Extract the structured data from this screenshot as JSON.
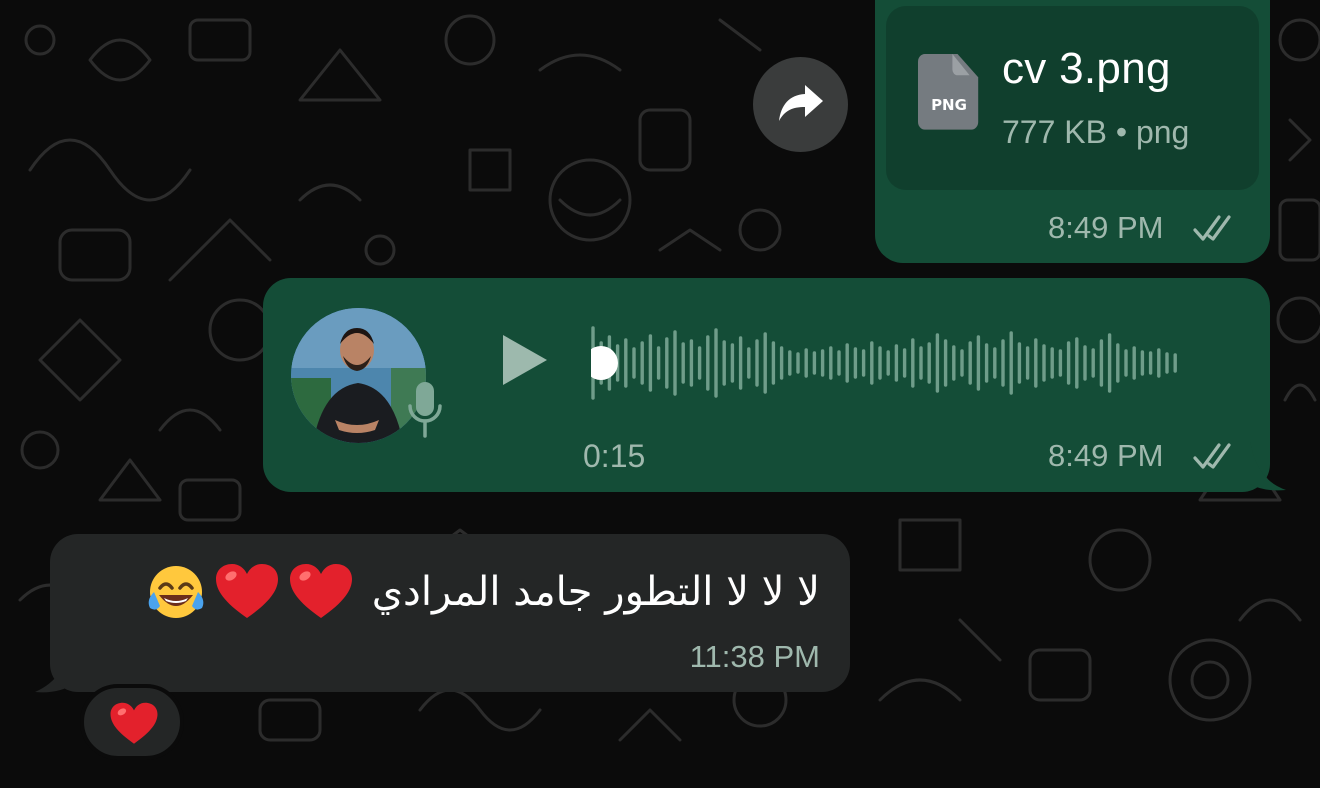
{
  "chat": {
    "file_message": {
      "file_type_badge": "PNG",
      "file_name": "cv 3.png",
      "file_meta": "777 KB • png",
      "time": "8:49 PM",
      "status": "read",
      "status_icon": "double-check-icon"
    },
    "forward_button": {
      "icon": "forward-arrow-icon"
    },
    "voice_message": {
      "duration": "0:15",
      "time": "8:49 PM",
      "status": "read",
      "status_icon": "double-check-icon",
      "progress": 0
    },
    "text_message": {
      "text": "لا لا لا التطور جامد المرادي",
      "emojis": [
        "red-heart-emoji",
        "red-heart-emoji",
        "face-with-tears-of-joy-emoji"
      ],
      "time": "11:38 PM"
    },
    "reaction": {
      "emoji": "red-heart-emoji"
    }
  },
  "colors": {
    "background": "#0b0b0b",
    "outgoing_bubble": "#144d37",
    "incoming_bubble": "#242626",
    "meta_text": "#9fb8ad",
    "file_card": "#103f2d"
  }
}
